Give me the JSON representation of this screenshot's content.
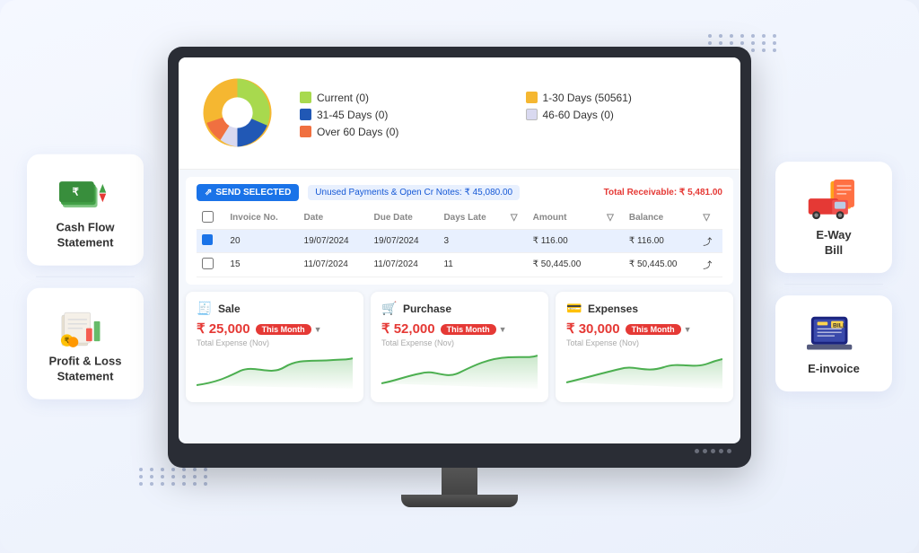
{
  "page": {
    "background_color": "#f0f4ff"
  },
  "left_sidebar": {
    "cards": [
      {
        "id": "cash-flow",
        "label": "Cash Flow\nStatement",
        "label_line1": "Cash Flow",
        "label_line2": "Statement"
      },
      {
        "id": "profit-loss",
        "label": "Profit & Loss\nStatement",
        "label_line1": "Profit & Loss",
        "label_line2": "Statement"
      }
    ]
  },
  "right_sidebar": {
    "cards": [
      {
        "id": "eway-bill",
        "label": "E-Way\nBill",
        "label_line1": "E-Way",
        "label_line2": "Bill"
      },
      {
        "id": "einvoice",
        "label": "E-invoice",
        "label_line1": "E-invoice",
        "label_line2": ""
      }
    ]
  },
  "monitor": {
    "legend": [
      {
        "label": "Current (0)",
        "color": "#a8d94e"
      },
      {
        "label": "1-30 Days (50561)",
        "color": "#f5b731"
      },
      {
        "label": "31-45 Days (0)",
        "color": "#2158b5"
      },
      {
        "label": "46-60 Days (0)",
        "color": "#d9d9f0"
      },
      {
        "label": "Over 60 Days (0)",
        "color": "#f07040"
      }
    ],
    "toolbar": {
      "send_btn": "SEND SELECTED",
      "unused_label": "Unused Payments & Open Cr Notes: ₹ 45,080.00",
      "total_receivable": "Total Receivable: ₹ 5,481.00"
    },
    "table": {
      "headers": [
        "",
        "Invoice No.",
        "Date",
        "Due Date",
        "Days Late",
        "",
        "Amount",
        "",
        "Balance",
        ""
      ],
      "rows": [
        {
          "checked": true,
          "invoice_no": "20",
          "date": "19/07/2024",
          "due_date": "19/07/2024",
          "days_late": "3",
          "amount": "₹ 116.00",
          "balance": "₹ 116.00"
        },
        {
          "checked": false,
          "invoice_no": "15",
          "date": "11/07/2024",
          "due_date": "11/07/2024",
          "days_late": "11",
          "amount": "₹ 50,445.00",
          "balance": "₹ 50,445.00"
        }
      ]
    },
    "stat_cards": [
      {
        "id": "sale",
        "title": "Sale",
        "icon": "🧾",
        "amount": "₹ 25,000",
        "badge": "This Month",
        "sub_label": "Total Expense (Nov)"
      },
      {
        "id": "purchase",
        "title": "Purchase",
        "icon": "🧾",
        "amount": "₹ 52,000",
        "badge": "This Month",
        "sub_label": "Total Expense (Nov)"
      },
      {
        "id": "expenses",
        "title": "Expenses",
        "icon": "🧾",
        "amount": "₹ 30,000",
        "badge": "This Month",
        "sub_label": "Total Expense (Nov)"
      }
    ]
  }
}
